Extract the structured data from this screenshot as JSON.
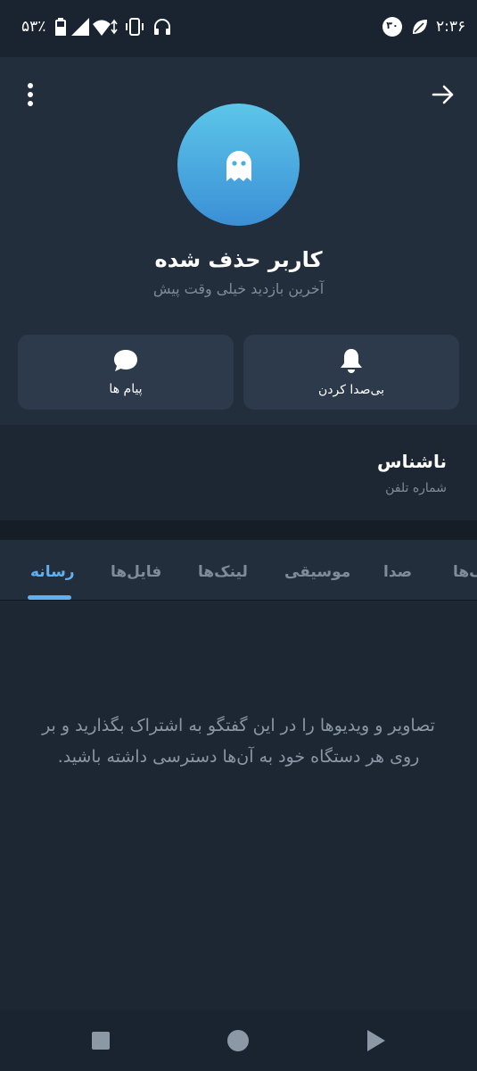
{
  "status_bar": {
    "time": "۲:۳۶",
    "battery": "۵۳٪",
    "notification_count": "۳۰",
    "icons": [
      "leaf-icon",
      "battery-icon",
      "signal-icon",
      "wifi-icon",
      "vibrate-icon",
      "headset-icon"
    ]
  },
  "profile": {
    "name": "کاربر حذف شده",
    "last_seen": "آخرین بازدید خیلی وقت پیش",
    "avatar_icon": "ghost-icon",
    "avatar_colors": [
      "#5cc6e8",
      "#3b8fd6"
    ]
  },
  "actions": {
    "mute_label": "بی‌صدا کردن",
    "messages_label": "پیام ها"
  },
  "info": {
    "title": "ناشناس",
    "subtitle": "شماره تلفن"
  },
  "tabs": [
    {
      "label": "رسانه",
      "active": true
    },
    {
      "label": "فایل‌ها",
      "active": false
    },
    {
      "label": "لینک‌ها",
      "active": false
    },
    {
      "label": "موسیقی",
      "active": false
    },
    {
      "label": "صدا",
      "active": false
    },
    {
      "label": "گیف‌ها",
      "active": false
    }
  ],
  "empty_state": {
    "text": "تصاویر و ویدیوها را در این گفتگو به اشتراک بگذارید و بر روی هر دستگاه خود به آن‌ها دسترسی داشته باشید."
  },
  "colors": {
    "accent": "#5fb0f0",
    "background": "#1d2733",
    "panel": "#232e3c",
    "button": "#2c3a4c"
  }
}
